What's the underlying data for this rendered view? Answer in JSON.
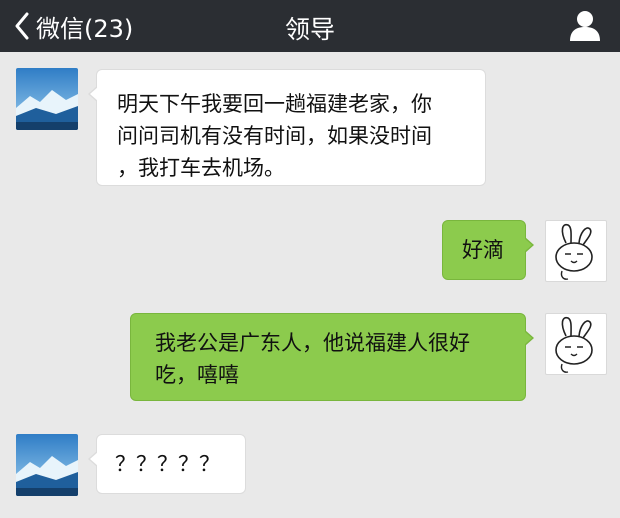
{
  "header": {
    "back_label": "微信(23)",
    "title": "领导",
    "icons": [
      "chevron-left-icon",
      "person-icon"
    ],
    "background": "#2b2e33"
  },
  "messages": [
    {
      "sender": "boss",
      "text": [
        "明天下午我要回一趟福建老家，你",
        "问问司机有没有时间，如果没时间",
        "，我打车去机场。"
      ]
    },
    {
      "sender": "me",
      "text": [
        "好滴"
      ]
    },
    {
      "sender": "me",
      "text": [
        "我老公是广东人，他说福建人很好",
        "吃，嘻嘻"
      ]
    },
    {
      "sender": "boss",
      "text": [
        "？？？？？"
      ]
    }
  ],
  "colors": {
    "chat_background": "#e9e9e9",
    "incoming_bubble": "#ffffff",
    "outgoing_bubble": "#8ccb4d"
  }
}
